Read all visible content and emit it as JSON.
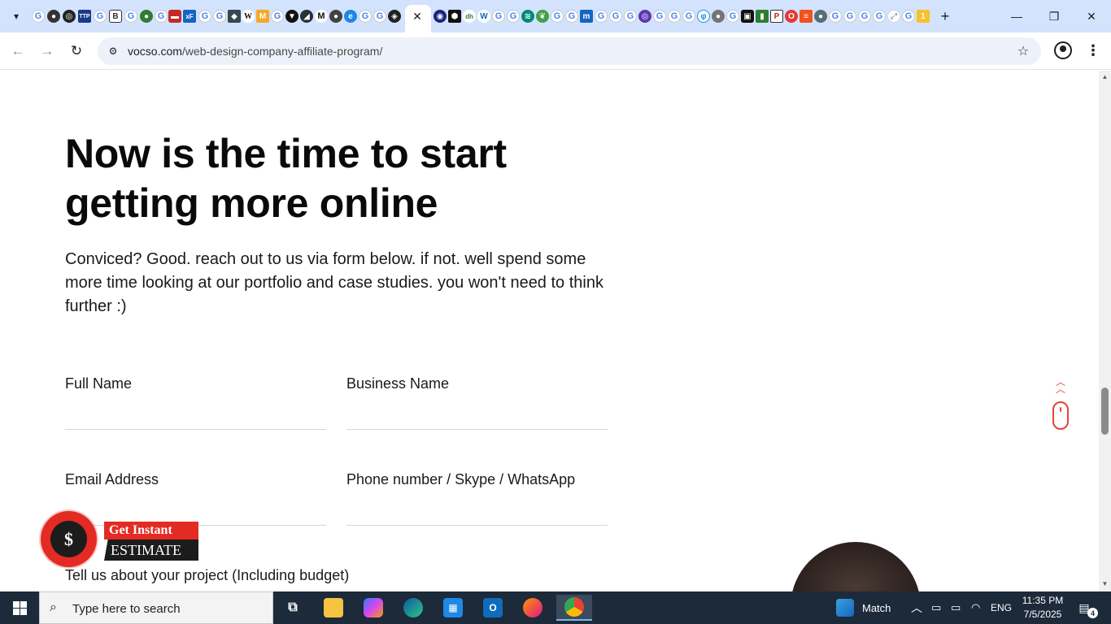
{
  "browser": {
    "tabs": {
      "favicons": [
        "google-icon",
        "generic-icon",
        "generic-icon",
        "ttp-icon",
        "google-icon",
        "generic-icon",
        "google-icon",
        "generic-icon",
        "google-icon",
        "generic-icon",
        "xf-icon",
        "google-icon",
        "google-icon",
        "generic-icon",
        "wikipedia-icon",
        "generic-icon",
        "google-icon",
        "generic-icon",
        "generic-icon",
        "m-icon",
        "generic-icon",
        "edge-icon",
        "google-icon",
        "google-icon",
        "generic-icon"
      ],
      "active_close": "✕",
      "right_favicons_count": 33
    },
    "window_controls": {
      "minimize": "—",
      "restore": "❐",
      "close": "✕"
    },
    "new_tab": "+",
    "url": {
      "domain": "vocso.com",
      "path": "/web-design-company-affiliate-program/"
    }
  },
  "page": {
    "headline": "Now is the time to start getting more online",
    "intro": "Conviced? Good. reach out to us via form below. if not. well spend some more time looking at our portfolio and case studies. you won't need to think further :)",
    "form": {
      "full_name_label": "Full Name",
      "business_name_label": "Business Name",
      "email_label": "Email Address",
      "phone_label": "Phone number / Skype / WhatsApp",
      "project_label": "Tell us about your project (Including budget)"
    },
    "estimate": {
      "symbol": "$",
      "line1": "Get Instant",
      "line2": "ESTIMATE"
    }
  },
  "taskbar": {
    "search_placeholder": "Type here to search",
    "weather_label": "Match",
    "language": "ENG",
    "time": "11:35 PM",
    "date": "7/5/2025",
    "notification_count": "4"
  },
  "colors": {
    "tabstrip": "#d3e3fd",
    "accent_red": "#e32b23",
    "taskbar": "#1c2a3a"
  }
}
